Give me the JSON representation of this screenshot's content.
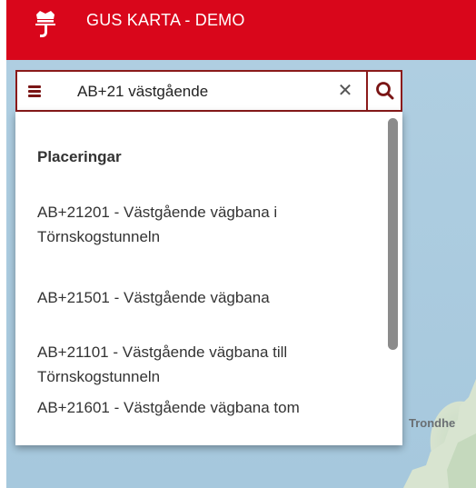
{
  "header": {
    "title": "GUS KARTA - DEMO"
  },
  "search": {
    "value": "AB+21 västgående"
  },
  "dropdown": {
    "section_label": "Placeringar",
    "results": [
      {
        "line1": "AB+21201 - Västgående vägbana i",
        "line2": "Törnskogstunneln"
      },
      {
        "line1": "AB+21501 - Västgående vägbana",
        "line2": ""
      },
      {
        "line1": "AB+21101 - Västgående vägbana till",
        "line2": "Törnskogstunneln"
      },
      {
        "line1": "AB+21601 - Västgående vägbana tom",
        "line2": ""
      }
    ]
  },
  "map": {
    "place_label": "Trondhe"
  },
  "colors": {
    "header_bg": "#d9061b",
    "search_border": "#8b1a1a",
    "water": "#a9cbe0"
  },
  "icons": {
    "menu": "hamburger-icon",
    "clear": "close-icon",
    "search": "search-icon",
    "logo": "crown-logo-icon"
  }
}
